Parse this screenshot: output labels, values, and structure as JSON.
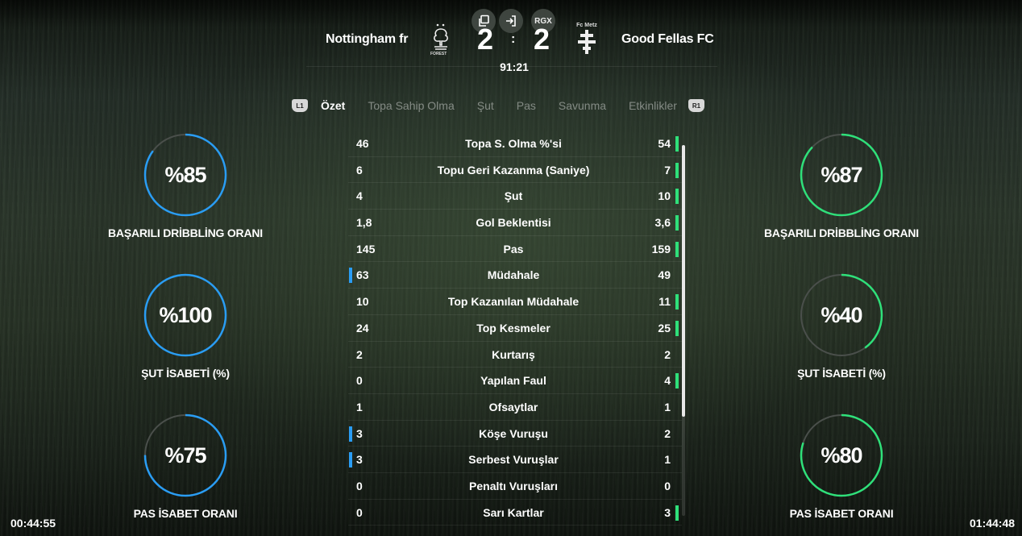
{
  "header": {
    "home_team": "Nottingham fr",
    "away_team": "Good Fellas  FC",
    "home_score": "2",
    "away_score": "2",
    "score_separator": ":",
    "match_time": "91:21",
    "away_crest_caption": "Fc Metz",
    "home_crest_caption": "FOREST",
    "buttons": {
      "rgx_label": "RGX"
    }
  },
  "tabs": {
    "left_shoulder": "L1",
    "right_shoulder": "R1",
    "items": [
      "Özet",
      "Topa Sahip Olma",
      "Şut",
      "Pas",
      "Savunma",
      "Etkinlikler"
    ],
    "active_index": 0
  },
  "home_rings": [
    {
      "value": "%85",
      "label": "BAŞARILI DRİBBLİNG ORANI",
      "percent": 85
    },
    {
      "value": "%100",
      "label": "ŞUT İSABETİ (%)",
      "percent": 100
    },
    {
      "value": "%75",
      "label": "PAS İSABET ORANI",
      "percent": 75
    }
  ],
  "away_rings": [
    {
      "value": "%87",
      "label": "BAŞARILI DRİBBLİNG ORANI",
      "percent": 87
    },
    {
      "value": "%40",
      "label": "ŞUT İSABETİ (%)",
      "percent": 40
    },
    {
      "value": "%80",
      "label": "PAS İSABET ORANI",
      "percent": 80
    }
  ],
  "stats": [
    {
      "home": "46",
      "name": "Topa S. Olma %'si",
      "away": "54",
      "leader": "away"
    },
    {
      "home": "6",
      "name": "Topu Geri Kazanma (Saniye)",
      "away": "7",
      "leader": "away"
    },
    {
      "home": "4",
      "name": "Şut",
      "away": "10",
      "leader": "away"
    },
    {
      "home": "1,8",
      "name": "Gol Beklentisi",
      "away": "3,6",
      "leader": "away"
    },
    {
      "home": "145",
      "name": "Pas",
      "away": "159",
      "leader": "away"
    },
    {
      "home": "63",
      "name": "Müdahale",
      "away": "49",
      "leader": "home"
    },
    {
      "home": "10",
      "name": "Top Kazanılan Müdahale",
      "away": "11",
      "leader": "away"
    },
    {
      "home": "24",
      "name": "Top Kesmeler",
      "away": "25",
      "leader": "away"
    },
    {
      "home": "2",
      "name": "Kurtarış",
      "away": "2",
      "leader": "none"
    },
    {
      "home": "0",
      "name": "Yapılan Faul",
      "away": "4",
      "leader": "away"
    },
    {
      "home": "1",
      "name": "Ofsaytlar",
      "away": "1",
      "leader": "none"
    },
    {
      "home": "3",
      "name": "Köşe Vuruşu",
      "away": "2",
      "leader": "home"
    },
    {
      "home": "3",
      "name": "Serbest Vuruşlar",
      "away": "1",
      "leader": "home"
    },
    {
      "home": "0",
      "name": "Penaltı Vuruşları",
      "away": "0",
      "leader": "none"
    },
    {
      "home": "0",
      "name": "Sarı Kartlar",
      "away": "3",
      "leader": "away"
    }
  ],
  "colors": {
    "home": "#2a9df4",
    "away": "#2fe07a",
    "ring_track": "#4a4f4b"
  },
  "clock_left": "00:44:55",
  "clock_right": "01:44:48"
}
